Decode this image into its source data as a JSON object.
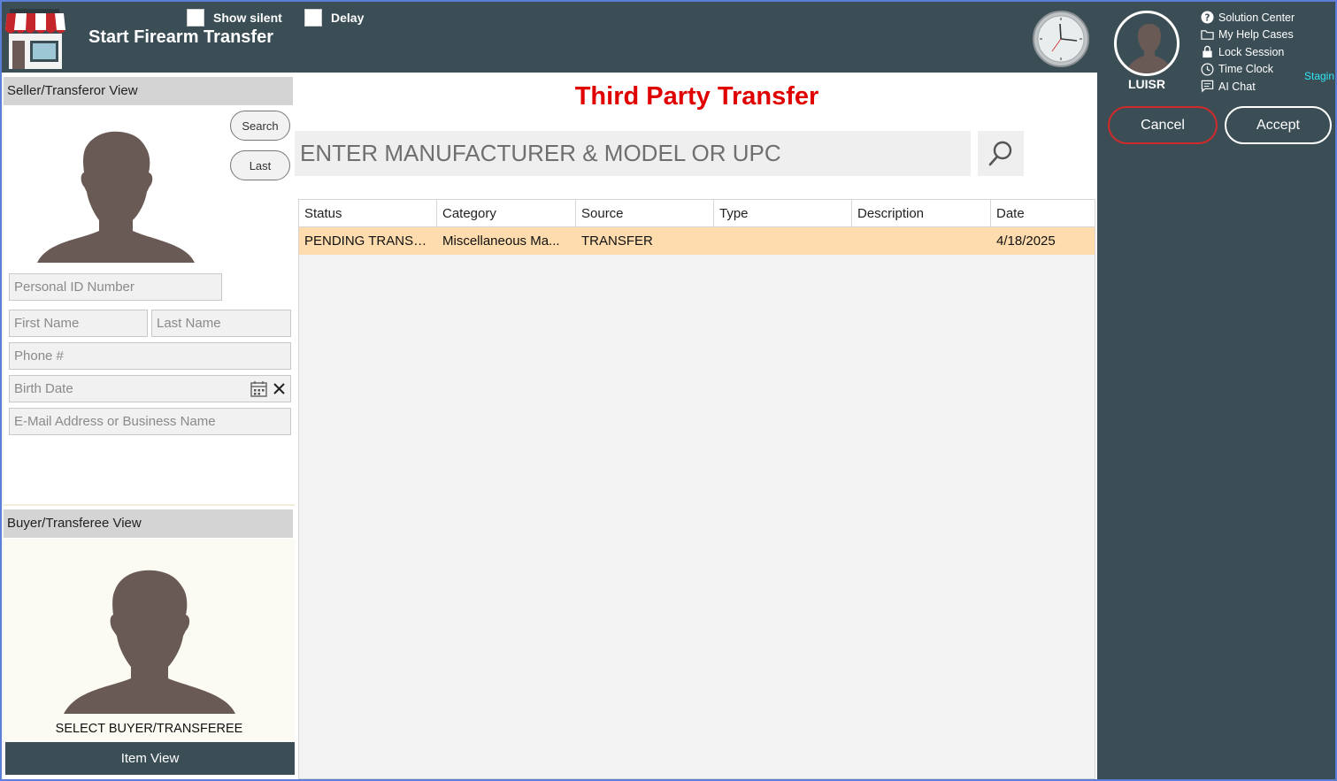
{
  "header": {
    "app_title": "Start Firearm Transfer",
    "show_silent_label": "Show silent",
    "delay_label": "Delay"
  },
  "user": {
    "name": "LUISR"
  },
  "help_menu": [
    {
      "label": "Solution Center",
      "icon": "question-circle-icon"
    },
    {
      "label": "My Help Cases",
      "icon": "folder-icon"
    },
    {
      "label": "Lock Session",
      "icon": "lock-icon"
    },
    {
      "label": "Time Clock",
      "icon": "clock-icon"
    },
    {
      "label": "AI Chat",
      "icon": "chat-icon"
    }
  ],
  "environment_label": "Stagin",
  "actions": {
    "cancel_label": "Cancel",
    "accept_label": "Accept"
  },
  "seller": {
    "header": "Seller/Transferor View",
    "search_label": "Search",
    "last_label": "Last",
    "personal_id_placeholder": "Personal ID Number",
    "first_name_placeholder": "First Name",
    "last_name_placeholder": "Last Name",
    "phone_placeholder": "Phone #",
    "birth_date_placeholder": "Birth Date",
    "email_placeholder": "E-Mail Address or Business Name"
  },
  "buyer": {
    "header": "Buyer/Transferee View",
    "select_label": "SELECT BUYER/TRANSFEREE"
  },
  "item_view_label": "Item View",
  "main": {
    "title": "Third Party Transfer",
    "search_placeholder": "ENTER MANUFACTURER & MODEL OR UPC"
  },
  "grid": {
    "columns": [
      "Status",
      "Category",
      "Source",
      "Type",
      "Description",
      "Date"
    ],
    "rows": [
      [
        "PENDING TRANSFER",
        "Miscellaneous Ma...",
        "TRANSFER",
        "",
        "",
        "4/18/2025"
      ]
    ]
  },
  "colors": {
    "header_bg": "#3b4e56",
    "title_red": "#e00000",
    "row_highlight": "#fedcae",
    "cancel_border": "#d12a2a",
    "staging_cyan": "#2ee6f2"
  }
}
